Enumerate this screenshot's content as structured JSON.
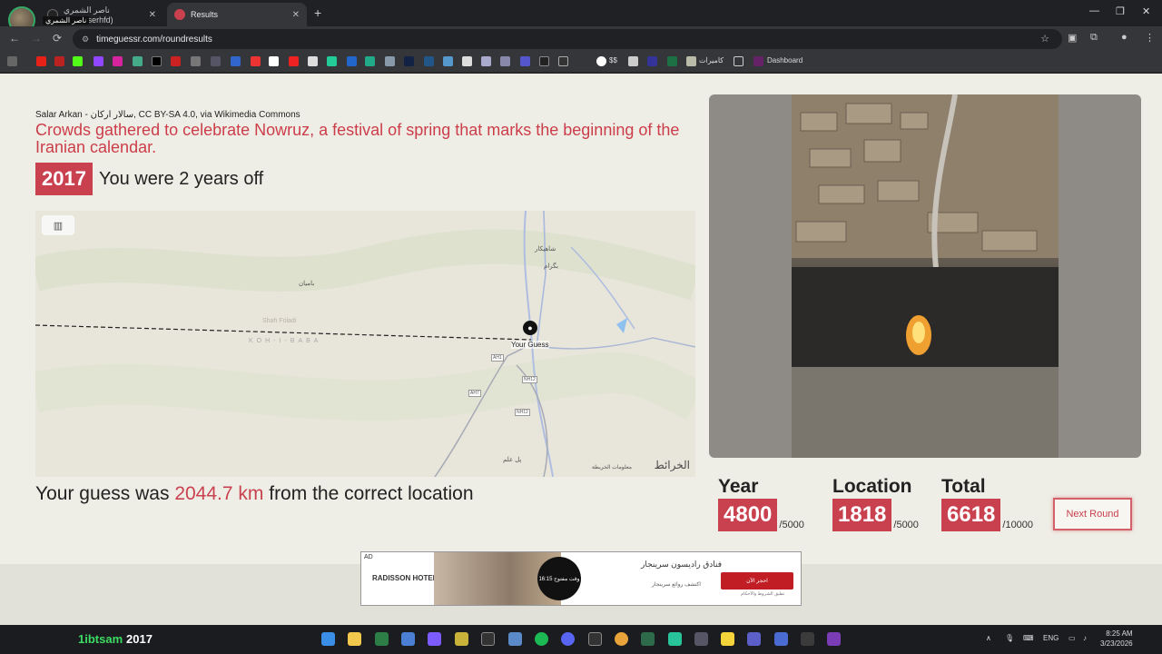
{
  "browser": {
    "tabs": [
      {
        "label": "ناصر الشمري (@nasserhfd)",
        "active": false
      },
      {
        "label": "Results",
        "active": true
      }
    ],
    "profile_name": "ناصر الشمري",
    "url": "timeguessr.com/roundresults",
    "bookmarks": {
      "dollar_label": "$$",
      "cameras_label": "كاميرات",
      "dashboard_label": "Dashboard"
    }
  },
  "round": {
    "attribution": "Salar Arkan - سالار ارکان, CC BY-SA 4.0, via Wikimedia Commons",
    "caption": "Crowds gathered to celebrate Nowruz, a festival of spring that marks the beginning of the Iranian calendar.",
    "correct_year": "2017",
    "years_off_text": "You were 2 years off",
    "distance_prefix": "Your guess was",
    "distance_value": "2044.7 km",
    "distance_suffix": "from the correct location"
  },
  "map": {
    "guess_label": "Your Guess",
    "labels": [
      "بامیان",
      "شاهیکار",
      "بگرام",
      "Shah Foladi",
      "KOH-I-BABA",
      "AH1",
      "AH7",
      "NH12",
      "NH12",
      "پل علم"
    ],
    "credit": "معلومات الخريطة",
    "logo_text": "الخرائط"
  },
  "scores": {
    "year": {
      "title": "Year",
      "value": "4800",
      "max": "/5000"
    },
    "location": {
      "title": "Location",
      "value": "1818",
      "max": "/5000"
    },
    "total": {
      "title": "Total",
      "value": "6618",
      "max": "/10000"
    },
    "next_round_label": "Next Round"
  },
  "ad": {
    "tag": "AD",
    "brand": "RADISSON HOTELS",
    "circle_text": "وقت مفتوح 16:15",
    "headline": "فنادق راديسون سرينجار",
    "subline": "اكتشف روائع سرينجار",
    "cta": "احجز الآن",
    "cta_sub": "تطبق الشروط والأحكام"
  },
  "taskbar": {
    "user": "1ibtsam",
    "year": "2017",
    "lang": "ENG",
    "time": "8:25 AM",
    "date": "3/23/2026"
  }
}
